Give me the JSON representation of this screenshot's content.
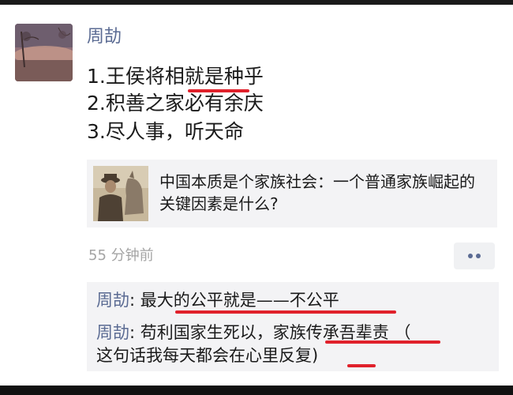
{
  "post": {
    "author": "周劼",
    "lines": [
      "1.王侯将相就是种乎",
      "2.积善之家必有余庆",
      "3.尽人事，听天命"
    ]
  },
  "share": {
    "title": "中国本质是个家族社会：一个普通家族崛起的关键因素是什么?"
  },
  "meta": {
    "time": "55 分钟前",
    "more_icon": "ellipsis-icon"
  },
  "comments": [
    {
      "name": "周劼",
      "sep": ": ",
      "text": "最大的公平就是——不公平"
    },
    {
      "name": "周劼",
      "sep": ": ",
      "text": "苟利国家生死以，家族传承吾辈责 （",
      "text_cont": "这句话我每天都会在心里反复)"
    }
  ],
  "colors": {
    "name_color": "#5b6b93",
    "highlight_underline": "#e0212b",
    "card_bg": "#f3f3f5"
  }
}
